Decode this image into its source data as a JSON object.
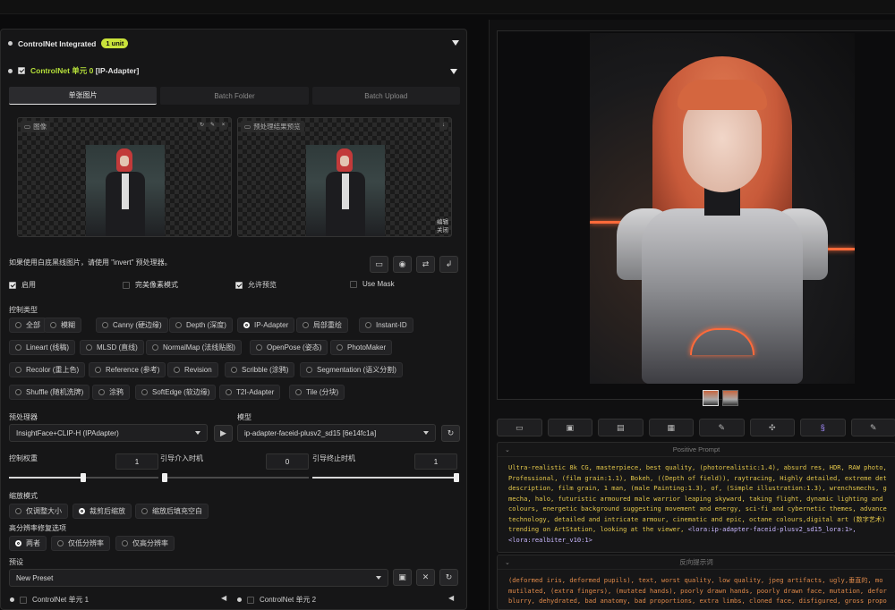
{
  "left": {
    "integrated_title": "ControlNet Integrated",
    "integrated_badge": "1 unit",
    "unit_title": "ControlNet 单元 0",
    "unit_tag": "[IP-Adapter]",
    "tabs": [
      "单张图片",
      "Batch Folder",
      "Batch Upload"
    ],
    "image_label": "图像",
    "preview_label": "预处理结果预览",
    "preview_footer_top": "编辑",
    "preview_footer_bottom": "关闭",
    "invert_note": "如果使用白底黑线图片，请使用 \"invert\" 预处理器。",
    "options": {
      "enable": "启用",
      "pixel_perfect": "完美像素模式",
      "allow_preview": "允许预览",
      "use_mask": "Use Mask"
    },
    "control_type_label": "控制类型",
    "control_types": [
      "全部",
      "模糊",
      "Canny (硬边缘)",
      "Depth (深度)",
      "IP-Adapter",
      "局部重绘",
      "Instant-ID",
      "Lineart (线稿)",
      "MLSD (直线)",
      "NormalMap (法线贴图)",
      "OpenPose (姿态)",
      "PhotoMaker",
      "Recolor (重上色)",
      "Reference (参考)",
      "Revision",
      "Scribble (涂鸦)",
      "Segmentation (语义分割)",
      "Shuffle (随机洗牌)",
      "涂鸦",
      "SoftEdge (软边缘)",
      "T2I-Adapter",
      "Tile (分块)"
    ],
    "selected_control_type": "IP-Adapter",
    "preprocessor_label": "预处理器",
    "preprocessor_value": "InsightFace+CLIP-H (IPAdapter)",
    "model_label": "模型",
    "model_value": "ip-adapter-faceid-plusv2_sd15 [6e14fc1a]",
    "weight_label": "控制权重",
    "weight_value": "1",
    "start_label": "引导介入时机",
    "start_value": "0",
    "end_label": "引导终止时机",
    "end_value": "1",
    "resize_label": "缩放模式",
    "resize_modes": [
      "仅调整大小",
      "裁剪后缩放",
      "缩放后填充空白"
    ],
    "resize_selected": "裁剪后缩放",
    "hires_label": "高分辨率修复选项",
    "hires_modes": [
      "两者",
      "仅低分辨率",
      "仅高分辨率"
    ],
    "hires_selected": "两者",
    "preset_label": "预设",
    "preset_value": "New Preset",
    "footer_unit1": "ControlNet 单元 1",
    "footer_unit2": "ControlNet 单元 2"
  },
  "right": {
    "positive_title": "Positive Prompt",
    "positive_lines": [
      "Ultra-realistic 8k CG, masterpiece, best quality, (photorealistic:1.4), absurd res, HDR, RAW photo,",
      "Professional, (film grain:1.1), Bokeh, ((Depth of field)), raytracing, Highly detailed, extreme det",
      "description, film grain, 1 man, (male Painting:1.3), of, (Simple illustration:1.3), wrenchsmechs, g",
      "mecha, halo, futuristic armoured male warrior leaping skyward, taking flight, dynamic lighting and",
      "colours, energetic background suggesting movement and energy, sci-fi and cybernetic themes, advance",
      "technology, detailed and intricate armour, cinematic and epic, octane colours,digital art (数字艺术)",
      "trending on ArtStation, looking at the viewer, "
    ],
    "positive_lora_1": "<lora:ip-adapter-faceid-plusv2_sd15_lora:1>,",
    "positive_lora_2": "<lora:realbiter_v10:1>",
    "negative_title": "反向提示词",
    "negative_lines": [
      "(deformed iris, deformed pupils), text, worst quality, low quality, jpeg artifacts, ugly,垂直的, mo",
      "mutilated, (extra fingers), (mutated hands), poorly drawn hands, poorly drawn face, mutation, defor",
      "blurry, dehydrated, bad anatomy, bad proportions, extra limbs, cloned face, disfigured, gross propo"
    ]
  }
}
